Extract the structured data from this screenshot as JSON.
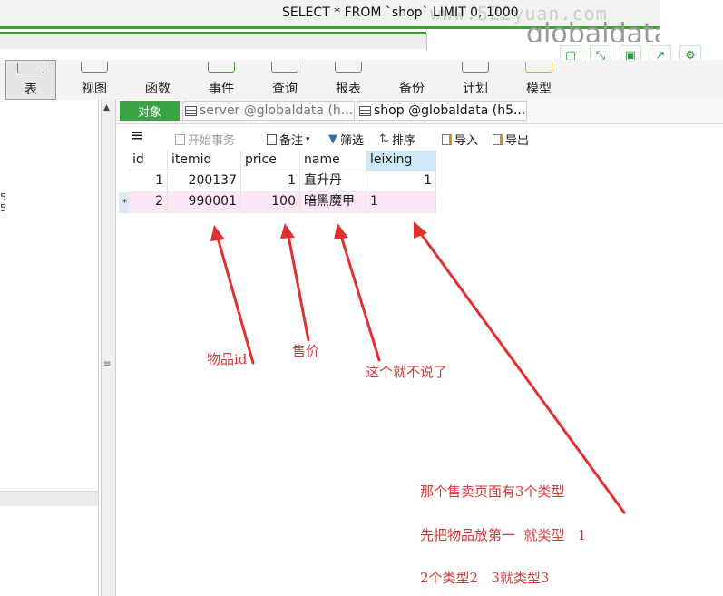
{
  "sql_bar": {
    "query": "SELECT * FROM `shop` LIMIT 0, 1000",
    "watermark": "www.522yuan.com",
    "connection_fragment": "globaldata"
  },
  "window_controls": [
    {
      "name": "pin-icon",
      "glyph": "▢"
    },
    {
      "name": "expand-icon",
      "glyph": "⤡"
    },
    {
      "name": "save-icon",
      "glyph": "▣"
    },
    {
      "name": "export-icon",
      "glyph": "↗"
    },
    {
      "name": "settings-icon",
      "glyph": "⚙"
    }
  ],
  "toolbar": {
    "items": [
      {
        "label": "表",
        "active": true
      },
      {
        "label": "视图"
      },
      {
        "label": "函数"
      },
      {
        "label": "事件"
      },
      {
        "label": "查询"
      },
      {
        "label": "报表"
      },
      {
        "label": "备份"
      },
      {
        "label": "计划"
      },
      {
        "label": "模型"
      }
    ]
  },
  "tabs": {
    "objects_label": "对象",
    "items": [
      {
        "label": "server @globaldata (h..."
      },
      {
        "label": "shop @globaldata (h5..."
      }
    ]
  },
  "subbar": {
    "menu_glyph": "≡",
    "begin_transaction": "开始事务",
    "memo": "备注",
    "filter": "筛选",
    "sort": "排序",
    "import": "导入",
    "export": "导出"
  },
  "grid": {
    "columns": [
      "id",
      "itemid",
      "price",
      "name",
      "leixing"
    ],
    "rows": [
      {
        "marker": "",
        "cells": [
          "1",
          "200137",
          "1",
          "直升丹",
          "1"
        ]
      },
      {
        "marker": "*",
        "cells": [
          "2",
          "990001",
          "100",
          "暗黑魔甲",
          "1"
        ]
      }
    ]
  },
  "annotations": {
    "item_id": "物品id",
    "price": "售价",
    "name_note": "这个就不说了",
    "type_line1": "那个售卖页面有3个类型",
    "type_line2": "先把物品放第一  就类型   1",
    "type_line3": "2个类型2   3就类型3"
  },
  "colors": {
    "accent_green": "#3aa346",
    "annotation_red": "#d23a3a",
    "selected_header": "#cfe8f7",
    "row_highlight": "#fce7f6"
  }
}
